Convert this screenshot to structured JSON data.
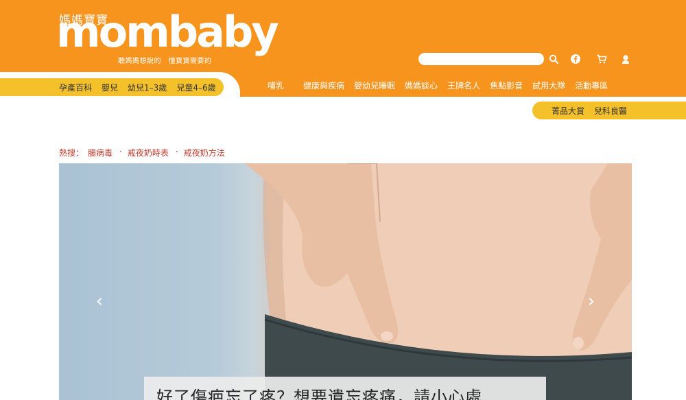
{
  "brand": {
    "name_cn": "媽媽寶寶",
    "name_en": "mombaby",
    "tagline": "聽媽媽想說的　懂寶寶需要的"
  },
  "search": {
    "placeholder": ""
  },
  "header_icons": [
    "search-icon",
    "facebook-icon",
    "cart-icon",
    "user-icon"
  ],
  "category_tabs": [
    "孕產百科",
    "嬰兒",
    "幼兒1–3歲",
    "兒童4–6歲"
  ],
  "main_nav": [
    "哺乳",
    "健康與疾病",
    "嬰幼兒睡眠",
    "媽媽談心",
    "王牌名人",
    "焦點影音",
    "試用大隊",
    "活動專區"
  ],
  "sub_tabs": [
    "菁品大賞",
    "兒科良醫"
  ],
  "hot_search": {
    "label": "熱搜：",
    "items": [
      "腸病毒",
      "戒夜奶時表",
      "戒夜奶方法"
    ]
  },
  "carousel": {
    "prev_label": "‹",
    "next_label": "›",
    "caption": "好了傷疤忘了疼？想要遺忘疼痛，請小心處"
  },
  "colors": {
    "header_orange": "#f7941d",
    "tab_yellow": "#f5c12a",
    "hot_red": "#c0392b"
  }
}
